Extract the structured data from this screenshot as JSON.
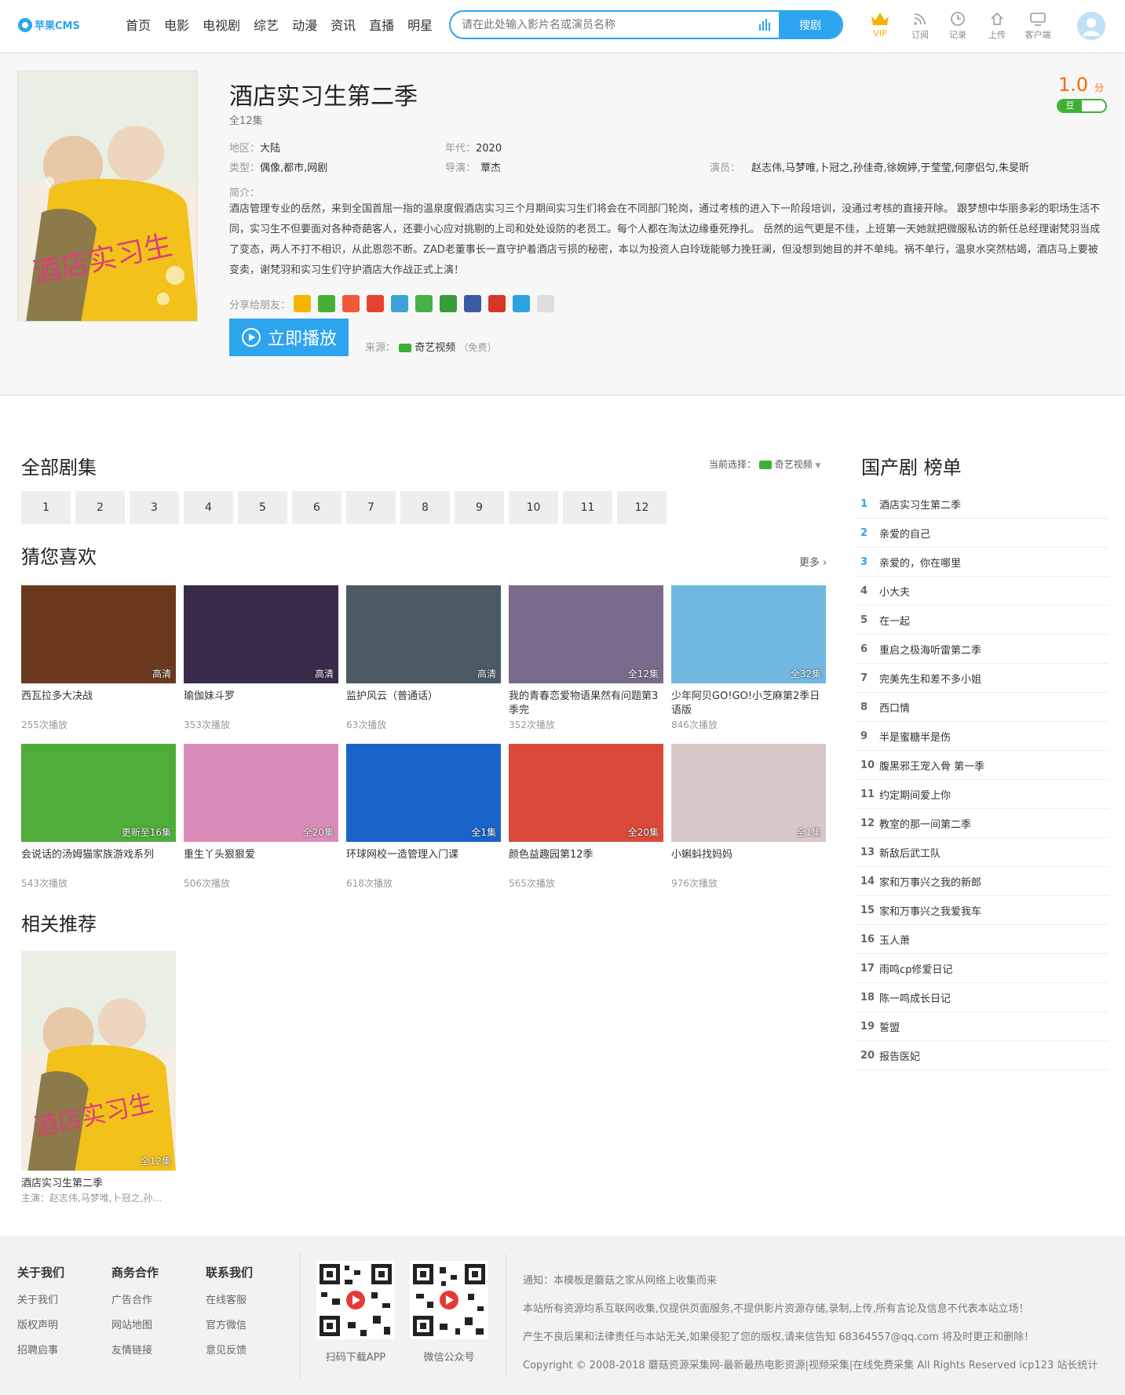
{
  "header": {
    "logo_text": "苹果CMS",
    "nav": [
      "首页",
      "电影",
      "电视剧",
      "综艺",
      "动漫",
      "资讯",
      "直播",
      "明星"
    ],
    "search_placeholder": "请在此处输入影片名或演员名称",
    "search_button": "搜剧",
    "tools": [
      "VIP",
      "订阅",
      "记录",
      "上传",
      "客户端"
    ]
  },
  "detail": {
    "title": "酒店实习生第二季",
    "episodes": "全12集",
    "region_label": "地区：",
    "region": "大陆",
    "year_label": "年代：",
    "year": "2020",
    "genre_label": "类型：",
    "genre": "偶像,都市,网剧",
    "director_label": "导演：",
    "director": "覃杰",
    "cast_label": "演员：",
    "cast": "赵志伟,马梦唯,卜冠之,孙佳奇,徐婉婷,于莹莹,何廖侣匀,朱旻昕",
    "intro_label": "简介：",
    "intro": "酒店管理专业的岳然，来到全国首屈一指的温泉度假酒店实习三个月期间实习生们将会在不同部门轮岗，通过考核的进入下一阶段培训，没通过考核的直接开除。 跟梦想中华丽多彩的职场生活不同，实习生不但要面对各种奇葩客人，还要小心应对挑剔的上司和处处设防的老员工。每个人都在淘汰边缘垂死挣扎。 岳然的运气更是不佳，上班第一天她就把微服私访的新任总经理谢梵羽当成了变态，两人不打不相识，从此恩怨不断。ZAD老董事长一直守护着酒店亏损的秘密，本以为投资人白玲珑能够力挽狂澜，但没想到她目的并不单纯。祸不单行，温泉水突然枯竭，酒店马上要被变卖，谢梵羽和实习生们守护酒店大作战正式上演！",
    "score": "1.0",
    "score_unit": "分",
    "douban": "豆",
    "share_label": "分享给朋友：",
    "play_button": "立即播放",
    "source_label": "来源：",
    "source_name": "奇艺视频",
    "source_note": "（免费）",
    "poster_text": "酒店实习生"
  },
  "episodes_section": {
    "title": "全部剧集",
    "current_label": "当前选择：",
    "current_source": "奇艺视频",
    "items": [
      "1",
      "2",
      "3",
      "4",
      "5",
      "6",
      "7",
      "8",
      "9",
      "10",
      "11",
      "12"
    ]
  },
  "guess": {
    "title": "猜您喜欢",
    "more": "更多",
    "items": [
      {
        "name": "西瓦拉多大决战",
        "note": "高清",
        "plays": "255次播放",
        "color": "#6b3a1e"
      },
      {
        "name": "瑜伽妹斗罗",
        "note": "高清",
        "plays": "353次播放",
        "color": "#3a2a4a"
      },
      {
        "name": "监护风云（普通话）",
        "note": "高清",
        "plays": "63次播放",
        "color": "#4c5a66"
      },
      {
        "name": "我的青春恋爱物语果然有问题第3季完",
        "note": "全12集",
        "plays": "352次播放",
        "color": "#7a6b8c"
      },
      {
        "name": "少年阿贝GO!GO!小芝麻第2季日语版",
        "note": "全32集",
        "plays": "846次播放",
        "color": "#6fb7e0"
      },
      {
        "name": "会说话的汤姆猫家族游戏系列",
        "note": "更新至16集",
        "plays": "543次播放",
        "color": "#4fae3a"
      },
      {
        "name": "重生丫头狠狠爱",
        "note": "全20集",
        "plays": "506次播放",
        "color": "#d98cb8"
      },
      {
        "name": "环球网校一造管理入门课",
        "note": "全1集",
        "plays": "618次播放",
        "color": "#1a63c9"
      },
      {
        "name": "颜色益趣园第12季",
        "note": "全20集",
        "plays": "565次播放",
        "color": "#d94a3a"
      },
      {
        "name": "小蝌蚪找妈妈",
        "note": "全1集",
        "plays": "976次播放",
        "color": "#d9c8c8"
      }
    ]
  },
  "related": {
    "title": "相关推荐",
    "name": "酒店实习生第二季",
    "note": "全12集",
    "cast": "主演：赵志伟,马梦唯,卜冠之,孙..."
  },
  "rank": {
    "title": "国产剧 榜单",
    "items": [
      "酒店实习生第二季",
      "亲爱的自己",
      "亲爱的，你在哪里",
      "小大夫",
      "在一起",
      "重启之极海听雷第二季",
      "完美先生和差不多小姐",
      "西口情",
      "半是蜜糖半是伤",
      "腹黑邪王宠入骨 第一季",
      "约定期间爱上你",
      "教室的那一间第二季",
      "新敌后武工队",
      "家和万事兴之我的新郎",
      "家和万事兴之我爱我车",
      "玉人萧",
      "雨鸣cp修爱日记",
      "陈一鸣成长日记",
      "誓盟",
      "报告医妃"
    ]
  },
  "footer": {
    "cols": [
      {
        "title": "关于我们",
        "links": [
          "关于我们",
          "版权声明",
          "招聘启事"
        ]
      },
      {
        "title": "商务合作",
        "links": [
          "广告合作",
          "网站地图",
          "友情链接"
        ]
      },
      {
        "title": "联系我们",
        "links": [
          "在线客服",
          "官方微信",
          "意见反馈"
        ]
      }
    ],
    "qr": [
      "扫码下载APP",
      "微信公众号"
    ],
    "notes": [
      "通知：本模板是蘑菇之家从网络上收集而来",
      "本站所有资源均系互联网收集,仅提供页面服务,不提供影片资源存储,录制,上传,所有言论及信息不代表本站立场！",
      "产生不良后果和法律责任与本站无关,如果侵犯了您的版权,请来信告知 68364557@qq.com 将及时更正和删除！",
      "Copyright © 2008-2018 蘑菇资源采集网-最新最热电影资源|视频采集|在线免费采集 All Rights Reserved icp123 站长统计"
    ]
  },
  "colors": {
    "accent": "#2da4ee",
    "score": "#ff6600",
    "douban": "#3eb135"
  }
}
